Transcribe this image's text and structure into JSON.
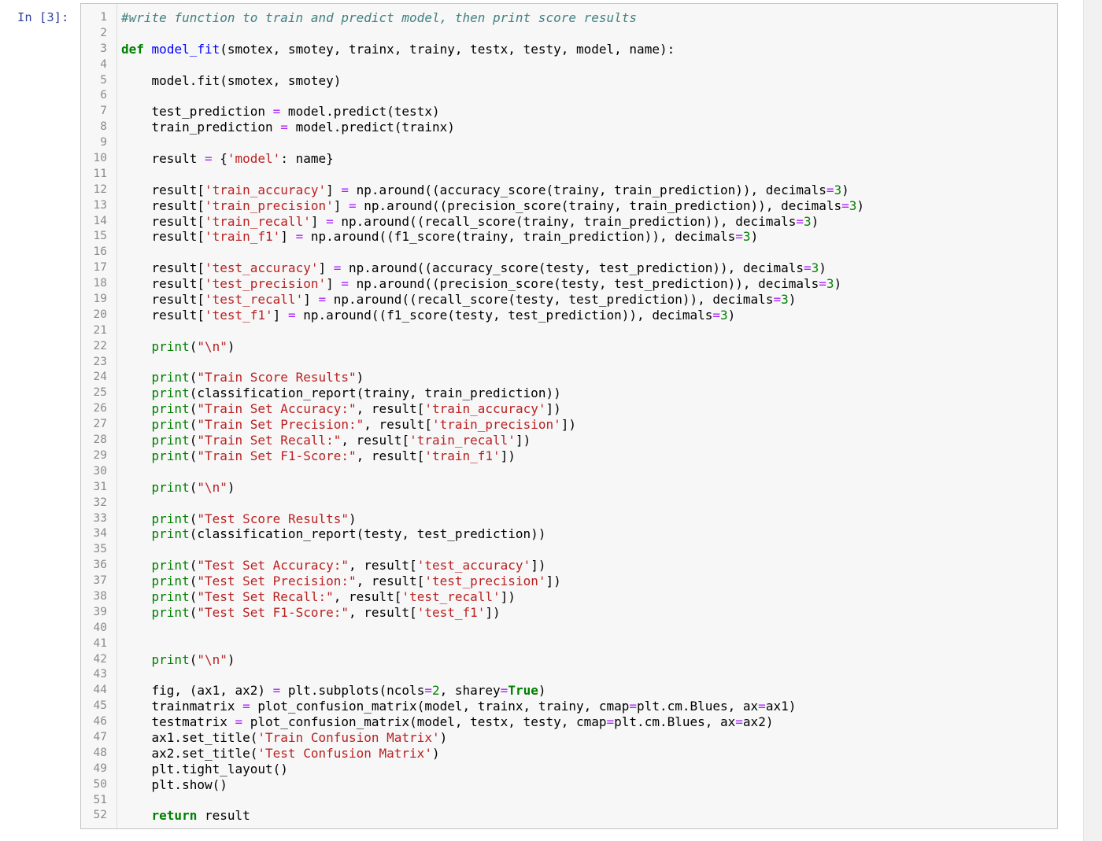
{
  "cell": {
    "prompt": "In [3]:",
    "lines": [
      {
        "n": "1",
        "t": [
          {
            "c": "cm",
            "v": "#write function to train and predict model, then print score results"
          }
        ]
      },
      {
        "n": "2",
        "t": []
      },
      {
        "n": "3",
        "t": [
          {
            "c": "kw",
            "v": "def"
          },
          {
            "c": "",
            "v": " "
          },
          {
            "c": "fn",
            "v": "model_fit"
          },
          {
            "c": "",
            "v": "(smotex, smotey, trainx, trainy, testx, testy, model, name):"
          }
        ]
      },
      {
        "n": "4",
        "t": []
      },
      {
        "n": "5",
        "t": [
          {
            "c": "",
            "v": "    model.fit(smotex, smotey)"
          }
        ]
      },
      {
        "n": "6",
        "t": []
      },
      {
        "n": "7",
        "t": [
          {
            "c": "",
            "v": "    test_prediction "
          },
          {
            "c": "op",
            "v": "="
          },
          {
            "c": "",
            "v": " model.predict(testx)"
          }
        ]
      },
      {
        "n": "8",
        "t": [
          {
            "c": "",
            "v": "    train_prediction "
          },
          {
            "c": "op",
            "v": "="
          },
          {
            "c": "",
            "v": " model.predict(trainx)"
          }
        ]
      },
      {
        "n": "9",
        "t": []
      },
      {
        "n": "10",
        "t": [
          {
            "c": "",
            "v": "    result "
          },
          {
            "c": "op",
            "v": "="
          },
          {
            "c": "",
            "v": " {"
          },
          {
            "c": "str",
            "v": "'model'"
          },
          {
            "c": "",
            "v": ": name}"
          }
        ]
      },
      {
        "n": "11",
        "t": []
      },
      {
        "n": "12",
        "t": [
          {
            "c": "",
            "v": "    result["
          },
          {
            "c": "str",
            "v": "'train_accuracy'"
          },
          {
            "c": "",
            "v": "] "
          },
          {
            "c": "op",
            "v": "="
          },
          {
            "c": "",
            "v": " np.around((accuracy_score(trainy, train_prediction)), decimals"
          },
          {
            "c": "op",
            "v": "="
          },
          {
            "c": "num",
            "v": "3"
          },
          {
            "c": "",
            "v": ")"
          }
        ]
      },
      {
        "n": "13",
        "t": [
          {
            "c": "",
            "v": "    result["
          },
          {
            "c": "str",
            "v": "'train_precision'"
          },
          {
            "c": "",
            "v": "] "
          },
          {
            "c": "op",
            "v": "="
          },
          {
            "c": "",
            "v": " np.around((precision_score(trainy, train_prediction)), decimals"
          },
          {
            "c": "op",
            "v": "="
          },
          {
            "c": "num",
            "v": "3"
          },
          {
            "c": "",
            "v": ")"
          }
        ]
      },
      {
        "n": "14",
        "t": [
          {
            "c": "",
            "v": "    result["
          },
          {
            "c": "str",
            "v": "'train_recall'"
          },
          {
            "c": "",
            "v": "] "
          },
          {
            "c": "op",
            "v": "="
          },
          {
            "c": "",
            "v": " np.around((recall_score(trainy, train_prediction)), decimals"
          },
          {
            "c": "op",
            "v": "="
          },
          {
            "c": "num",
            "v": "3"
          },
          {
            "c": "",
            "v": ")"
          }
        ]
      },
      {
        "n": "15",
        "t": [
          {
            "c": "",
            "v": "    result["
          },
          {
            "c": "str",
            "v": "'train_f1'"
          },
          {
            "c": "",
            "v": "] "
          },
          {
            "c": "op",
            "v": "="
          },
          {
            "c": "",
            "v": " np.around((f1_score(trainy, train_prediction)), decimals"
          },
          {
            "c": "op",
            "v": "="
          },
          {
            "c": "num",
            "v": "3"
          },
          {
            "c": "",
            "v": ")"
          }
        ]
      },
      {
        "n": "16",
        "t": []
      },
      {
        "n": "17",
        "t": [
          {
            "c": "",
            "v": "    result["
          },
          {
            "c": "str",
            "v": "'test_accuracy'"
          },
          {
            "c": "",
            "v": "] "
          },
          {
            "c": "op",
            "v": "="
          },
          {
            "c": "",
            "v": " np.around((accuracy_score(testy, test_prediction)), decimals"
          },
          {
            "c": "op",
            "v": "="
          },
          {
            "c": "num",
            "v": "3"
          },
          {
            "c": "",
            "v": ")"
          }
        ]
      },
      {
        "n": "18",
        "t": [
          {
            "c": "",
            "v": "    result["
          },
          {
            "c": "str",
            "v": "'test_precision'"
          },
          {
            "c": "",
            "v": "] "
          },
          {
            "c": "op",
            "v": "="
          },
          {
            "c": "",
            "v": " np.around((precision_score(testy, test_prediction)), decimals"
          },
          {
            "c": "op",
            "v": "="
          },
          {
            "c": "num",
            "v": "3"
          },
          {
            "c": "",
            "v": ")"
          }
        ]
      },
      {
        "n": "19",
        "t": [
          {
            "c": "",
            "v": "    result["
          },
          {
            "c": "str",
            "v": "'test_recall'"
          },
          {
            "c": "",
            "v": "] "
          },
          {
            "c": "op",
            "v": "="
          },
          {
            "c": "",
            "v": " np.around((recall_score(testy, test_prediction)), decimals"
          },
          {
            "c": "op",
            "v": "="
          },
          {
            "c": "num",
            "v": "3"
          },
          {
            "c": "",
            "v": ")"
          }
        ]
      },
      {
        "n": "20",
        "t": [
          {
            "c": "",
            "v": "    result["
          },
          {
            "c": "str",
            "v": "'test_f1'"
          },
          {
            "c": "",
            "v": "] "
          },
          {
            "c": "op",
            "v": "="
          },
          {
            "c": "",
            "v": " np.around((f1_score(testy, test_prediction)), decimals"
          },
          {
            "c": "op",
            "v": "="
          },
          {
            "c": "num",
            "v": "3"
          },
          {
            "c": "",
            "v": ")"
          }
        ]
      },
      {
        "n": "21",
        "t": []
      },
      {
        "n": "22",
        "t": [
          {
            "c": "",
            "v": "    "
          },
          {
            "c": "bi",
            "v": "print"
          },
          {
            "c": "",
            "v": "("
          },
          {
            "c": "str",
            "v": "\"\\n\""
          },
          {
            "c": "",
            "v": ")"
          }
        ]
      },
      {
        "n": "23",
        "t": []
      },
      {
        "n": "24",
        "t": [
          {
            "c": "",
            "v": "    "
          },
          {
            "c": "bi",
            "v": "print"
          },
          {
            "c": "",
            "v": "("
          },
          {
            "c": "str",
            "v": "\"Train Score Results\""
          },
          {
            "c": "",
            "v": ")"
          }
        ]
      },
      {
        "n": "25",
        "t": [
          {
            "c": "",
            "v": "    "
          },
          {
            "c": "bi",
            "v": "print"
          },
          {
            "c": "",
            "v": "(classification_report(trainy, train_prediction))"
          }
        ]
      },
      {
        "n": "26",
        "t": [
          {
            "c": "",
            "v": "    "
          },
          {
            "c": "bi",
            "v": "print"
          },
          {
            "c": "",
            "v": "("
          },
          {
            "c": "str",
            "v": "\"Train Set Accuracy:\""
          },
          {
            "c": "",
            "v": ", result["
          },
          {
            "c": "str",
            "v": "'train_accuracy'"
          },
          {
            "c": "",
            "v": "])"
          }
        ]
      },
      {
        "n": "27",
        "t": [
          {
            "c": "",
            "v": "    "
          },
          {
            "c": "bi",
            "v": "print"
          },
          {
            "c": "",
            "v": "("
          },
          {
            "c": "str",
            "v": "\"Train Set Precision:\""
          },
          {
            "c": "",
            "v": ", result["
          },
          {
            "c": "str",
            "v": "'train_precision'"
          },
          {
            "c": "",
            "v": "])"
          }
        ]
      },
      {
        "n": "28",
        "t": [
          {
            "c": "",
            "v": "    "
          },
          {
            "c": "bi",
            "v": "print"
          },
          {
            "c": "",
            "v": "("
          },
          {
            "c": "str",
            "v": "\"Train Set Recall:\""
          },
          {
            "c": "",
            "v": ", result["
          },
          {
            "c": "str",
            "v": "'train_recall'"
          },
          {
            "c": "",
            "v": "])"
          }
        ]
      },
      {
        "n": "29",
        "t": [
          {
            "c": "",
            "v": "    "
          },
          {
            "c": "bi",
            "v": "print"
          },
          {
            "c": "",
            "v": "("
          },
          {
            "c": "str",
            "v": "\"Train Set F1-Score:\""
          },
          {
            "c": "",
            "v": ", result["
          },
          {
            "c": "str",
            "v": "'train_f1'"
          },
          {
            "c": "",
            "v": "])"
          }
        ]
      },
      {
        "n": "30",
        "t": []
      },
      {
        "n": "31",
        "t": [
          {
            "c": "",
            "v": "    "
          },
          {
            "c": "bi",
            "v": "print"
          },
          {
            "c": "",
            "v": "("
          },
          {
            "c": "str",
            "v": "\"\\n\""
          },
          {
            "c": "",
            "v": ")"
          }
        ]
      },
      {
        "n": "32",
        "t": []
      },
      {
        "n": "33",
        "t": [
          {
            "c": "",
            "v": "    "
          },
          {
            "c": "bi",
            "v": "print"
          },
          {
            "c": "",
            "v": "("
          },
          {
            "c": "str",
            "v": "\"Test Score Results\""
          },
          {
            "c": "",
            "v": ")"
          }
        ]
      },
      {
        "n": "34",
        "t": [
          {
            "c": "",
            "v": "    "
          },
          {
            "c": "bi",
            "v": "print"
          },
          {
            "c": "",
            "v": "(classification_report(testy, test_prediction))"
          }
        ]
      },
      {
        "n": "35",
        "t": []
      },
      {
        "n": "36",
        "t": [
          {
            "c": "",
            "v": "    "
          },
          {
            "c": "bi",
            "v": "print"
          },
          {
            "c": "",
            "v": "("
          },
          {
            "c": "str",
            "v": "\"Test Set Accuracy:\""
          },
          {
            "c": "",
            "v": ", result["
          },
          {
            "c": "str",
            "v": "'test_accuracy'"
          },
          {
            "c": "",
            "v": "])"
          }
        ]
      },
      {
        "n": "37",
        "t": [
          {
            "c": "",
            "v": "    "
          },
          {
            "c": "bi",
            "v": "print"
          },
          {
            "c": "",
            "v": "("
          },
          {
            "c": "str",
            "v": "\"Test Set Precision:\""
          },
          {
            "c": "",
            "v": ", result["
          },
          {
            "c": "str",
            "v": "'test_precision'"
          },
          {
            "c": "",
            "v": "])"
          }
        ]
      },
      {
        "n": "38",
        "t": [
          {
            "c": "",
            "v": "    "
          },
          {
            "c": "bi",
            "v": "print"
          },
          {
            "c": "",
            "v": "("
          },
          {
            "c": "str",
            "v": "\"Test Set Recall:\""
          },
          {
            "c": "",
            "v": ", result["
          },
          {
            "c": "str",
            "v": "'test_recall'"
          },
          {
            "c": "",
            "v": "])"
          }
        ]
      },
      {
        "n": "39",
        "t": [
          {
            "c": "",
            "v": "    "
          },
          {
            "c": "bi",
            "v": "print"
          },
          {
            "c": "",
            "v": "("
          },
          {
            "c": "str",
            "v": "\"Test Set F1-Score:\""
          },
          {
            "c": "",
            "v": ", result["
          },
          {
            "c": "str",
            "v": "'test_f1'"
          },
          {
            "c": "",
            "v": "])"
          }
        ]
      },
      {
        "n": "40",
        "t": []
      },
      {
        "n": "41",
        "t": []
      },
      {
        "n": "42",
        "t": [
          {
            "c": "",
            "v": "    "
          },
          {
            "c": "bi",
            "v": "print"
          },
          {
            "c": "",
            "v": "("
          },
          {
            "c": "str",
            "v": "\"\\n\""
          },
          {
            "c": "",
            "v": ")"
          }
        ]
      },
      {
        "n": "43",
        "t": []
      },
      {
        "n": "44",
        "t": [
          {
            "c": "",
            "v": "    fig, (ax1, ax2) "
          },
          {
            "c": "op",
            "v": "="
          },
          {
            "c": "",
            "v": " plt.subplots(ncols"
          },
          {
            "c": "op",
            "v": "="
          },
          {
            "c": "num",
            "v": "2"
          },
          {
            "c": "",
            "v": ", sharey"
          },
          {
            "c": "op",
            "v": "="
          },
          {
            "c": "kw",
            "v": "True"
          },
          {
            "c": "",
            "v": ")"
          }
        ]
      },
      {
        "n": "45",
        "t": [
          {
            "c": "",
            "v": "    trainmatrix "
          },
          {
            "c": "op",
            "v": "="
          },
          {
            "c": "",
            "v": " plot_confusion_matrix(model, trainx, trainy, cmap"
          },
          {
            "c": "op",
            "v": "="
          },
          {
            "c": "",
            "v": "plt.cm.Blues, ax"
          },
          {
            "c": "op",
            "v": "="
          },
          {
            "c": "",
            "v": "ax1)"
          }
        ]
      },
      {
        "n": "46",
        "t": [
          {
            "c": "",
            "v": "    testmatrix "
          },
          {
            "c": "op",
            "v": "="
          },
          {
            "c": "",
            "v": " plot_confusion_matrix(model, testx, testy, cmap"
          },
          {
            "c": "op",
            "v": "="
          },
          {
            "c": "",
            "v": "plt.cm.Blues, ax"
          },
          {
            "c": "op",
            "v": "="
          },
          {
            "c": "",
            "v": "ax2)"
          }
        ]
      },
      {
        "n": "47",
        "t": [
          {
            "c": "",
            "v": "    ax1.set_title("
          },
          {
            "c": "str",
            "v": "'Train Confusion Matrix'"
          },
          {
            "c": "",
            "v": ")"
          }
        ]
      },
      {
        "n": "48",
        "t": [
          {
            "c": "",
            "v": "    ax2.set_title("
          },
          {
            "c": "str",
            "v": "'Test Confusion Matrix'"
          },
          {
            "c": "",
            "v": ")"
          }
        ]
      },
      {
        "n": "49",
        "t": [
          {
            "c": "",
            "v": "    plt.tight_layout()"
          }
        ]
      },
      {
        "n": "50",
        "t": [
          {
            "c": "",
            "v": "    plt.show()"
          }
        ]
      },
      {
        "n": "51",
        "t": []
      },
      {
        "n": "52",
        "t": [
          {
            "c": "",
            "v": "    "
          },
          {
            "c": "kw",
            "v": "return"
          },
          {
            "c": "",
            "v": " result"
          }
        ]
      }
    ]
  },
  "colors": {
    "keyword": "#008000",
    "function_name": "#0000ff",
    "string": "#ba2121",
    "number": "#008000",
    "operator": "#aa22ff",
    "comment": "#408080",
    "prompt": "#303f9f"
  }
}
